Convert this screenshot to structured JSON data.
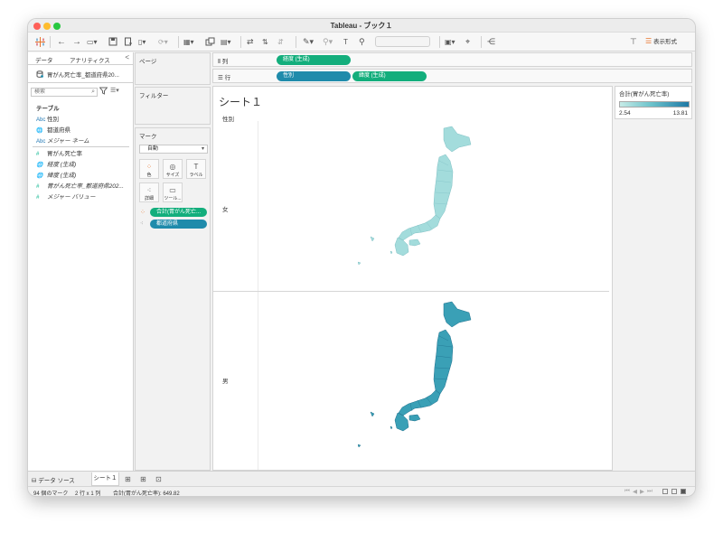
{
  "window": {
    "title": "Tableau - ブック１"
  },
  "toolbar": {
    "show_me": "表示形式",
    "font_dropdown_value": ""
  },
  "data_pane": {
    "tabs": [
      "データ",
      "アナリティクス"
    ],
    "collapse": "<",
    "source": "胃がん死亡率_都道府県20...",
    "search_placeholder": "検索",
    "section": "テーブル",
    "fields": [
      {
        "type": "Abc",
        "name": "性別",
        "kind": "dim"
      },
      {
        "type": "geo",
        "name": "都道府県",
        "kind": "dim"
      },
      {
        "type": "Abc",
        "name": "メジャー ネーム",
        "kind": "dim"
      },
      {
        "type": "#",
        "name": "胃がん死亡率",
        "kind": "meas"
      },
      {
        "type": "geo",
        "name": "経度 (生成)",
        "kind": "meas"
      },
      {
        "type": "geo",
        "name": "緯度 (生成)",
        "kind": "meas"
      },
      {
        "type": "#",
        "name": "胃がん死亡率_都道府県202...",
        "kind": "meas"
      },
      {
        "type": "#",
        "name": "メジャー バリュー",
        "kind": "meas"
      }
    ]
  },
  "pages_card": {
    "title": "ページ"
  },
  "filters_card": {
    "title": "フィルター"
  },
  "marks_card": {
    "title": "マーク",
    "type": "自動",
    "buttons": [
      "色",
      "サイズ",
      "ラベル",
      "詳細",
      "ツール..."
    ],
    "pills": [
      {
        "label": "合計(胃がん死亡...",
        "color": "#13ae7c"
      },
      {
        "label": "都道府県",
        "color": "#1f8bab"
      }
    ]
  },
  "shelves": {
    "columns": {
      "label": "列",
      "pill": "経度 (生成)"
    },
    "rows": {
      "label": "行",
      "pills": [
        "性別",
        "緯度 (生成)"
      ]
    }
  },
  "viz": {
    "sheet_title": "シート１",
    "row_header": "性別",
    "rows": [
      {
        "label": "女",
        "fill": "#a3dcdc",
        "stroke": "#7fc0c4"
      },
      {
        "label": "男",
        "fill": "#3aa0b6",
        "stroke": "#1d6f8c"
      }
    ]
  },
  "legend": {
    "title": "合計(胃がん死亡率)",
    "min": "2.54",
    "max": "13.81",
    "color_low": "#c6ebe7",
    "color_high": "#1f79a6"
  },
  "bottom_tabs": {
    "data_source": "データ ソース",
    "sheet": "シート１"
  },
  "status": {
    "marks": "94 個のマーク",
    "rows_cols": "2 行 x 1 列",
    "sum": "合計(胃がん死亡率): 649.82"
  }
}
